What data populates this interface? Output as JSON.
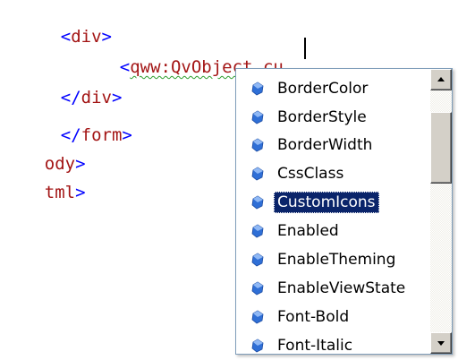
{
  "editor": {
    "lines": [
      {
        "bracket_open": "<",
        "tag": "div",
        "bracket_close": ">"
      },
      {
        "bracket_open": "<",
        "tag": "qww:QvObject",
        "space": " ",
        "attr": "cu"
      },
      {
        "bracket_open": "</",
        "tag": "div",
        "bracket_close": ">"
      },
      {
        "bracket_open": "</",
        "tag": "form",
        "bracket_close": ">"
      },
      {
        "tag": "ody",
        "bracket_close": ">"
      },
      {
        "tag": "tml",
        "bracket_close": ">"
      }
    ]
  },
  "completion": {
    "items": [
      {
        "label": "BorderColor",
        "icon": "property-icon"
      },
      {
        "label": "BorderStyle",
        "icon": "property-icon"
      },
      {
        "label": "BorderWidth",
        "icon": "property-icon"
      },
      {
        "label": "CssClass",
        "icon": "property-icon"
      },
      {
        "label": "CustomIcons",
        "icon": "property-icon"
      },
      {
        "label": "Enabled",
        "icon": "property-icon"
      },
      {
        "label": "EnableTheming",
        "icon": "property-icon"
      },
      {
        "label": "EnableViewState",
        "icon": "property-icon"
      },
      {
        "label": "Font-Bold",
        "icon": "property-icon"
      },
      {
        "label": "Font-Italic",
        "icon": "property-icon"
      }
    ],
    "selected": "CustomIcons"
  },
  "colors": {
    "bracket": "#0000ff",
    "tag": "#a31515",
    "selection": "#0a246a",
    "icon": "#2f6fd6"
  }
}
